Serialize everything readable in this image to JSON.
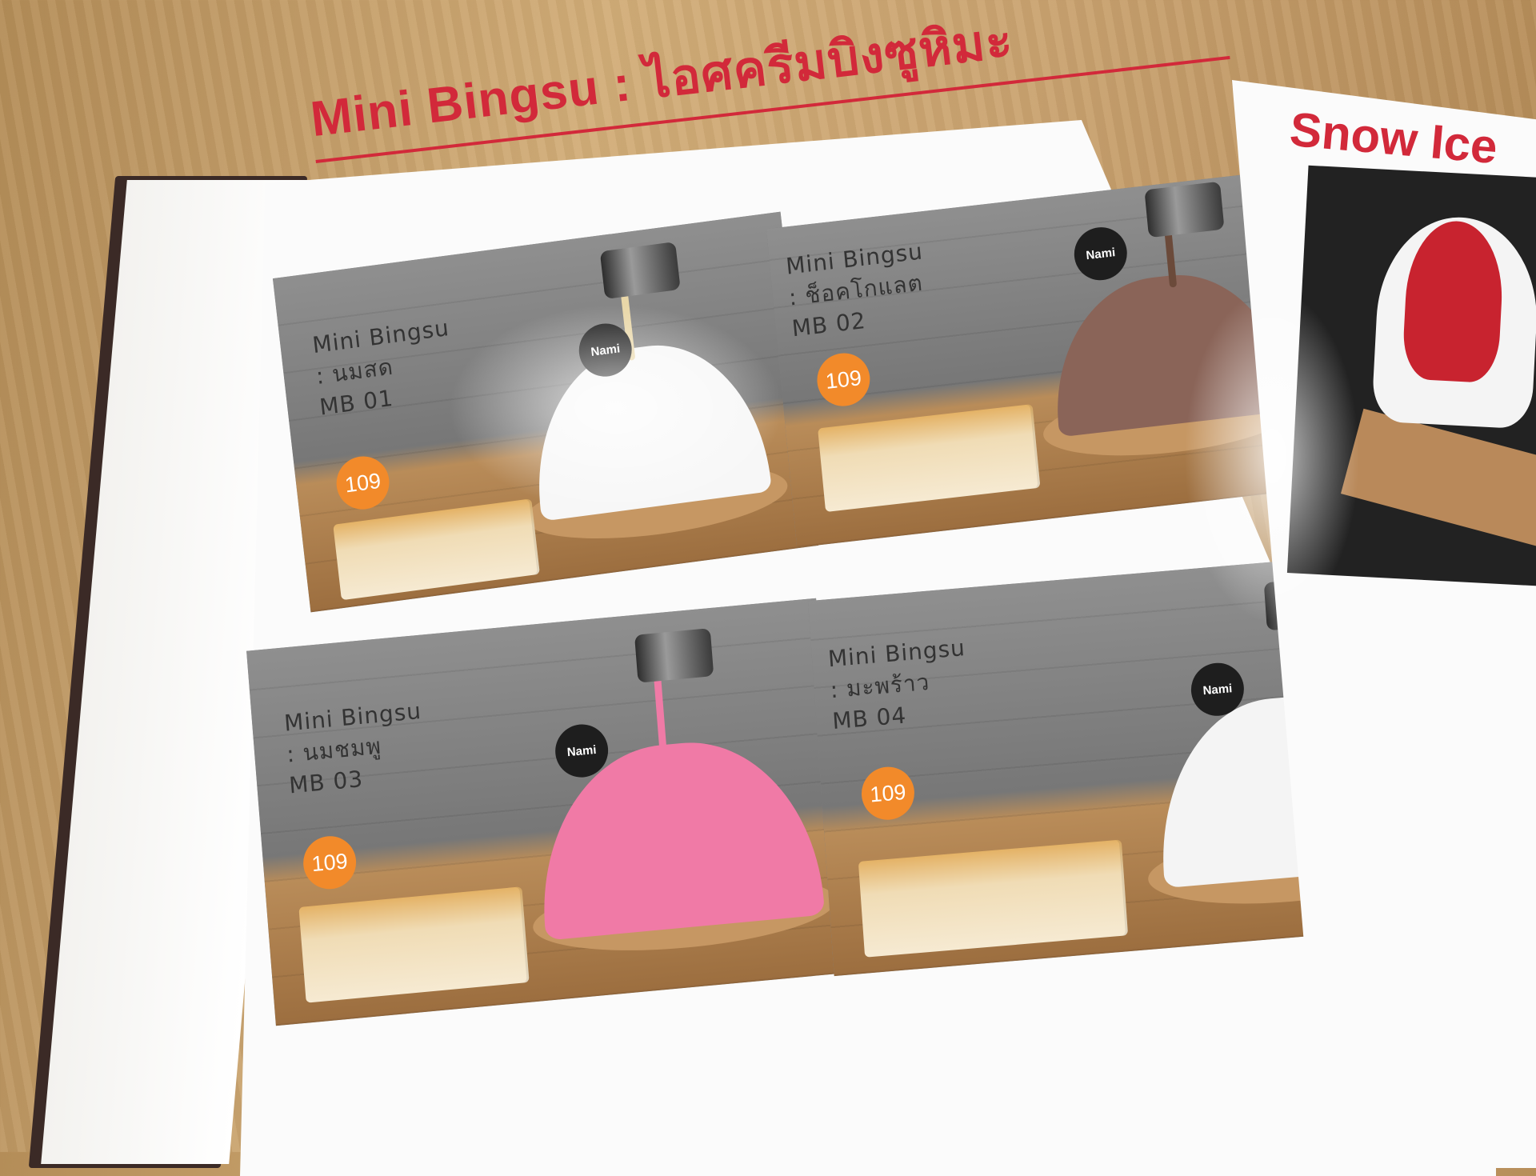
{
  "menu": {
    "title": "Mini Bingsu : ไอศครีมบิงซูหิมะ",
    "next_page_title": "Snow Ice",
    "items": [
      {
        "name": "Mini Bingsu",
        "flavor": ": นมสด",
        "code": "MB 01",
        "price": "109",
        "color": "#f7f7f7",
        "syrup": "#e9d7a8"
      },
      {
        "name": "Mini Bingsu",
        "flavor": ": ช็อคโกแลต",
        "code": "MB 02",
        "price": "109",
        "color": "#8a6458",
        "syrup": "#6b4a3a"
      },
      {
        "name": "Mini Bingsu",
        "flavor": ": นมชมพู",
        "code": "MB 03",
        "price": "109",
        "color": "#f07aa6",
        "syrup": "#f07aa6"
      },
      {
        "name": "Mini Bingsu",
        "flavor": ": มะพร้าว",
        "code": "MB 04",
        "price": "109",
        "color": "#f4f4f4",
        "syrup": "#ecdcb6"
      }
    ],
    "badge_text": "Nami"
  }
}
